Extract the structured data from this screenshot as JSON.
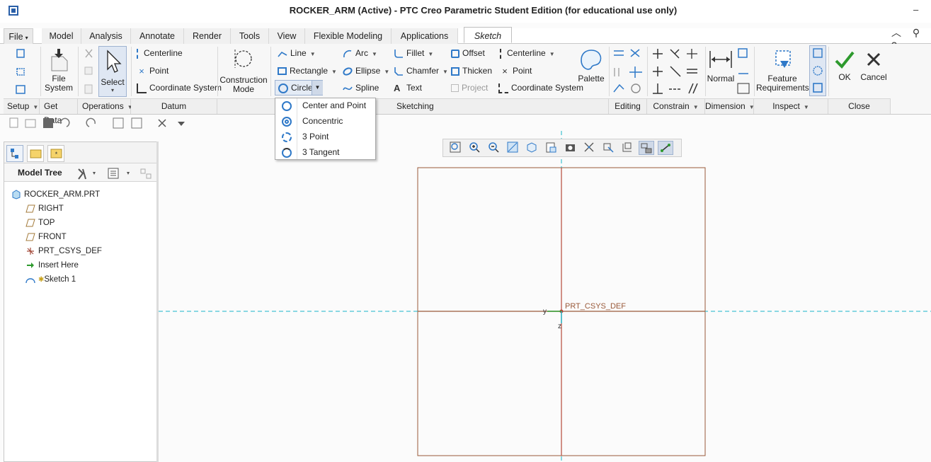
{
  "window": {
    "title": "ROCKER_ARM (Active) - PTC Creo Parametric Student Edition (for educational use only)",
    "minimize_glyph": "–"
  },
  "tabs": [
    {
      "label": "File",
      "caret": "▾"
    },
    {
      "label": "Model"
    },
    {
      "label": "Analysis"
    },
    {
      "label": "Annotate"
    },
    {
      "label": "Render"
    },
    {
      "label": "Tools"
    },
    {
      "label": "View"
    },
    {
      "label": "Flexible Modeling"
    },
    {
      "label": "Applications"
    },
    {
      "label": "Sketch",
      "active": true
    }
  ],
  "tab_right_icons": "︿ ⚲ ?",
  "ribbon": {
    "setup": {
      "label": "Setup"
    },
    "get_data": {
      "file_system": "File\nSystem",
      "label": "Get Data"
    },
    "operations": {
      "select": "Select",
      "label": "Operations"
    },
    "datum": {
      "centerline": "Centerline",
      "point": "Point",
      "coordinate_system": "Coordinate System",
      "label": "Datum"
    },
    "construction": {
      "label": "Construction\nMode"
    },
    "sketching": {
      "line": "Line",
      "arc": "Arc",
      "fillet": "Fillet",
      "offset": "Offset",
      "centerline": "Centerline",
      "rectangle": "Rectangle",
      "ellipse": "Ellipse",
      "chamfer": "Chamfer",
      "thicken": "Thicken",
      "point": "Point",
      "circle": "Circle",
      "spline": "Spline",
      "text": "Text",
      "project": "Project",
      "coordinate_system": "Coordinate System",
      "palette": "Palette",
      "label": "Sketching"
    },
    "editing": {
      "label": "Editing"
    },
    "constrain": {
      "label": "Constrain"
    },
    "dimension": {
      "normal": "Normal",
      "label": "Dimension"
    },
    "inspect": {
      "feature_requirements": "Feature\nRequirements",
      "label": "Inspect"
    },
    "close": {
      "ok": "OK",
      "cancel": "Cancel",
      "label": "Close"
    }
  },
  "circle_menu": {
    "items": [
      "Center and Point",
      "Concentric",
      "3 Point",
      "3 Tangent"
    ]
  },
  "model_tree": {
    "title": "Model Tree",
    "items": [
      {
        "label": "ROCKER_ARM.PRT",
        "icon": "part-icon"
      },
      {
        "label": "RIGHT",
        "icon": "datum-plane-icon"
      },
      {
        "label": "TOP",
        "icon": "datum-plane-icon"
      },
      {
        "label": "FRONT",
        "icon": "datum-plane-icon"
      },
      {
        "label": "PRT_CSYS_DEF",
        "icon": "csys-icon"
      },
      {
        "label": "Insert Here",
        "icon": "insert-arrow-icon"
      },
      {
        "label": "Sketch 1",
        "icon": "sketch-icon"
      }
    ]
  },
  "graphics": {
    "csys_label": "PRT_CSYS_DEF",
    "axis_y": "y",
    "axis_z": "z"
  },
  "colors": {
    "accent_blue": "#2f79c8",
    "ok_green": "#2e9a2e",
    "sketch_border": "#9a5a3a",
    "reference_cyan": "#19b6c9",
    "reference_red": "#b54a3a"
  }
}
